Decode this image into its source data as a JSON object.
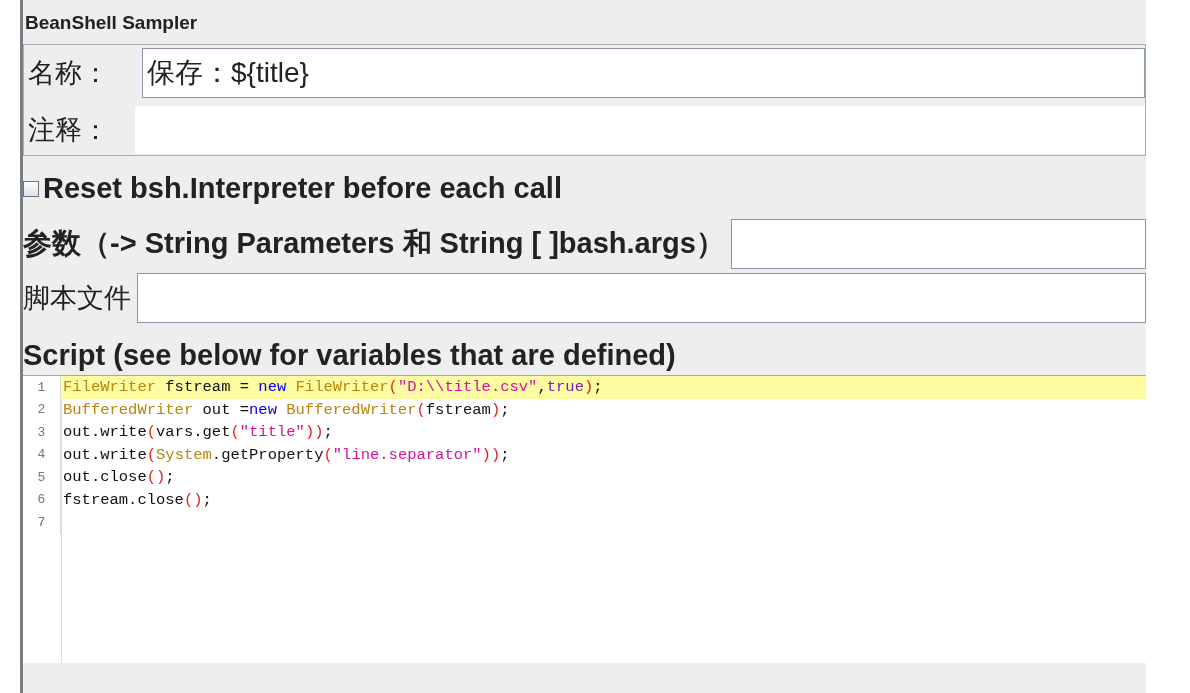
{
  "panel": {
    "title": "BeanShell Sampler"
  },
  "name_field": {
    "label": "名称：",
    "value": "保存：${title}"
  },
  "comment_field": {
    "label": "注释："
  },
  "reset_option": {
    "label": "Reset bsh.Interpreter before each call",
    "checked": false
  },
  "parameters_field": {
    "label": "参数（-> String Parameters 和 String [ ]bash.args）"
  },
  "script_file_field": {
    "label": "脚本文件"
  },
  "script": {
    "title": "Script (see below for variables that are defined)",
    "lines": [
      {
        "number": "1",
        "highlighted": true,
        "tokens": [
          {
            "kind": "type",
            "text": "FileWriter"
          },
          {
            "kind": "plain",
            "text": " fstream = "
          },
          {
            "kind": "keyword",
            "text": "new"
          },
          {
            "kind": "type",
            "text": " FileWriter"
          },
          {
            "kind": "paren",
            "text": "("
          },
          {
            "kind": "string",
            "text": "\"D:\\\\title.csv\""
          },
          {
            "kind": "plain",
            "text": ","
          },
          {
            "kind": "literal",
            "text": "true"
          },
          {
            "kind": "paren",
            "text": ")"
          },
          {
            "kind": "plain",
            "text": ";"
          }
        ]
      },
      {
        "number": "2",
        "highlighted": false,
        "tokens": [
          {
            "kind": "type",
            "text": "BufferedWriter"
          },
          {
            "kind": "plain",
            "text": " out ="
          },
          {
            "kind": "keyword",
            "text": "new"
          },
          {
            "kind": "type",
            "text": " BufferedWriter"
          },
          {
            "kind": "paren",
            "text": "("
          },
          {
            "kind": "plain",
            "text": "fstream"
          },
          {
            "kind": "paren",
            "text": ")"
          },
          {
            "kind": "plain",
            "text": ";"
          }
        ]
      },
      {
        "number": "3",
        "highlighted": false,
        "tokens": [
          {
            "kind": "plain",
            "text": "out.write"
          },
          {
            "kind": "paren",
            "text": "("
          },
          {
            "kind": "plain",
            "text": "vars.get"
          },
          {
            "kind": "paren",
            "text": "("
          },
          {
            "kind": "string",
            "text": "\"title\""
          },
          {
            "kind": "paren",
            "text": "))"
          },
          {
            "kind": "plain",
            "text": ";"
          }
        ]
      },
      {
        "number": "4",
        "highlighted": false,
        "tokens": [
          {
            "kind": "plain",
            "text": "out.write"
          },
          {
            "kind": "paren",
            "text": "("
          },
          {
            "kind": "type",
            "text": "System"
          },
          {
            "kind": "plain",
            "text": ".getProperty"
          },
          {
            "kind": "paren",
            "text": "("
          },
          {
            "kind": "string",
            "text": "\"line.separator\""
          },
          {
            "kind": "paren",
            "text": "))"
          },
          {
            "kind": "plain",
            "text": ";"
          }
        ]
      },
      {
        "number": "5",
        "highlighted": false,
        "tokens": [
          {
            "kind": "plain",
            "text": "out.close"
          },
          {
            "kind": "paren",
            "text": "()"
          },
          {
            "kind": "plain",
            "text": ";"
          }
        ]
      },
      {
        "number": "6",
        "highlighted": false,
        "tokens": [
          {
            "kind": "plain",
            "text": "fstream.close"
          },
          {
            "kind": "paren",
            "text": "()"
          },
          {
            "kind": "plain",
            "text": ";"
          }
        ]
      },
      {
        "number": "7",
        "highlighted": false
      }
    ]
  }
}
